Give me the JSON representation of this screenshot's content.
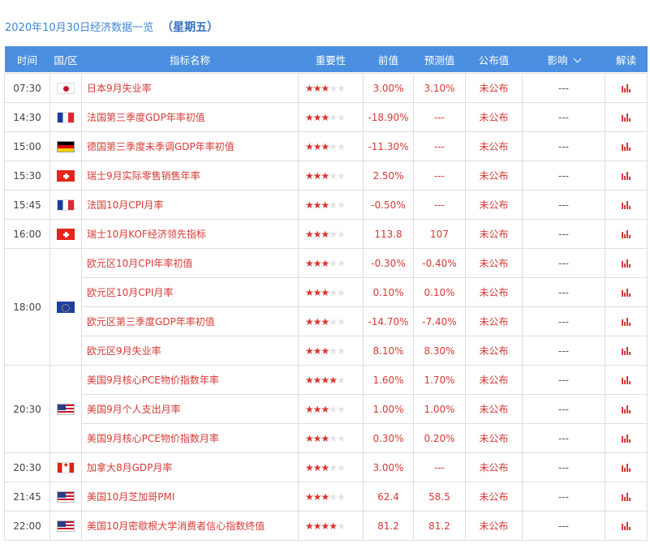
{
  "header": {
    "date": "2020年10月30日经济数据一览",
    "weekday": "（星期五）"
  },
  "columns": [
    "时间",
    "国/区",
    "指标名称",
    "重要性",
    "前值",
    "预测值",
    "公布值",
    "影响",
    "解读"
  ],
  "groups": [
    {
      "time": "07:30",
      "flag": "jp",
      "rows": [
        {
          "name": "日本9月失业率",
          "stars": 3,
          "prev": "3.00%",
          "forecast": "3.10%",
          "actual": "未公布",
          "impact": "---"
        }
      ]
    },
    {
      "time": "14:30",
      "flag": "fr",
      "rows": [
        {
          "name": "法国第三季度GDP年率初值",
          "stars": 3,
          "prev": "-18.90%",
          "forecast": "---",
          "actual": "未公布",
          "impact": "---"
        }
      ]
    },
    {
      "time": "15:00",
      "flag": "de",
      "rows": [
        {
          "name": "德国第三季度未季调GDP年率初值",
          "stars": 3,
          "prev": "-11.30%",
          "forecast": "---",
          "actual": "未公布",
          "impact": "---"
        }
      ]
    },
    {
      "time": "15:30",
      "flag": "ch",
      "rows": [
        {
          "name": "瑞士9月实际零售销售年率",
          "stars": 3,
          "prev": "2.50%",
          "forecast": "---",
          "actual": "未公布",
          "impact": "---"
        }
      ]
    },
    {
      "time": "15:45",
      "flag": "fr",
      "rows": [
        {
          "name": "法国10月CPI月率",
          "stars": 3,
          "prev": "-0.50%",
          "forecast": "---",
          "actual": "未公布",
          "impact": "---"
        }
      ]
    },
    {
      "time": "16:00",
      "flag": "ch",
      "rows": [
        {
          "name": "瑞士10月KOF经济领先指标",
          "stars": 3,
          "prev": "113.8",
          "forecast": "107",
          "actual": "未公布",
          "impact": "---"
        }
      ]
    },
    {
      "time": "18:00",
      "flag": "eu",
      "rows": [
        {
          "name": "欧元区10月CPI年率初值",
          "stars": 3,
          "prev": "-0.30%",
          "forecast": "-0.40%",
          "actual": "未公布",
          "impact": "---"
        },
        {
          "name": "欧元区10月CPI月率",
          "stars": 3,
          "prev": "0.10%",
          "forecast": "0.10%",
          "actual": "未公布",
          "impact": "---"
        },
        {
          "name": "欧元区第三季度GDP年率初值",
          "stars": 3,
          "prev": "-14.70%",
          "forecast": "-7.40%",
          "actual": "未公布",
          "impact": "---"
        },
        {
          "name": "欧元区9月失业率",
          "stars": 3,
          "prev": "8.10%",
          "forecast": "8.30%",
          "actual": "未公布",
          "impact": "---"
        }
      ]
    },
    {
      "time": "20:30",
      "flag": "us",
      "rows": [
        {
          "name": "美国9月核心PCE物价指数年率",
          "stars": 4,
          "prev": "1.60%",
          "forecast": "1.70%",
          "actual": "未公布",
          "impact": "---"
        },
        {
          "name": "美国9月个人支出月率",
          "stars": 3,
          "prev": "1.00%",
          "forecast": "1.00%",
          "actual": "未公布",
          "impact": "---"
        },
        {
          "name": "美国9月核心PCE物价指数月率",
          "stars": 3,
          "prev": "0.30%",
          "forecast": "0.20%",
          "actual": "未公布",
          "impact": "---"
        }
      ]
    },
    {
      "time": "20:30",
      "flag": "ca",
      "rows": [
        {
          "name": "加拿大8月GDP月率",
          "stars": 3,
          "prev": "3.00%",
          "forecast": "---",
          "actual": "未公布",
          "impact": "---"
        }
      ]
    },
    {
      "time": "21:45",
      "flag": "us",
      "rows": [
        {
          "name": "美国10月芝加哥PMI",
          "stars": 3,
          "prev": "62.4",
          "forecast": "58.5",
          "actual": "未公布",
          "impact": "---"
        }
      ]
    },
    {
      "time": "22:00",
      "flag": "us",
      "rows": [
        {
          "name": "美国10月密歇根大学消费者信心指数终值",
          "stars": 4,
          "prev": "81.2",
          "forecast": "81.2",
          "actual": "未公布",
          "impact": "---"
        }
      ]
    }
  ],
  "colors": {
    "header_bg": "#4b8fe0",
    "title": "#3d86d6",
    "accent_red": "#d63a36",
    "border": "#dedede"
  },
  "icons": {
    "detail": "bar-chart-icon",
    "sort": "chevron-down-icon",
    "star": "star-icon"
  }
}
